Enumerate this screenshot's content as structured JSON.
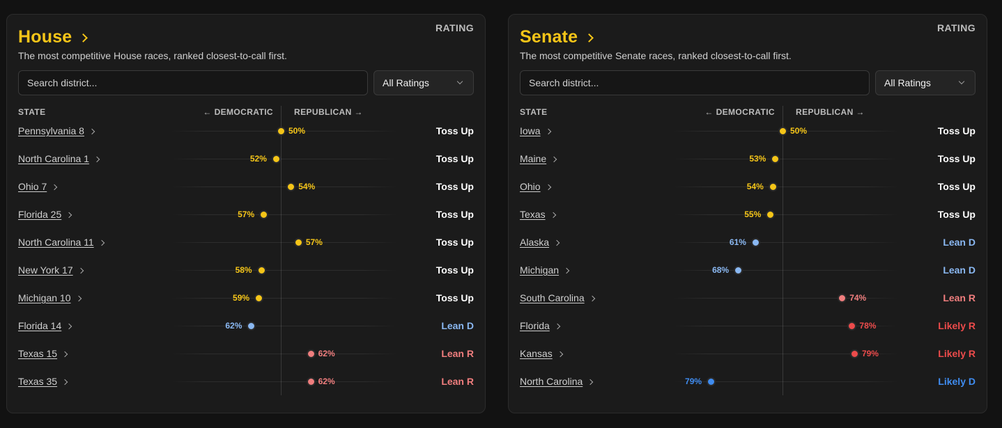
{
  "colors": {
    "tossup": "#f5c518",
    "lean_d": "#8ab8f2",
    "likely_d": "#3f8cf0",
    "lean_r": "#f07e7e",
    "likely_r": "#ec4b4b",
    "tossup_label": "#ffffff"
  },
  "house": {
    "title": "House",
    "subtitle": "The most competitive House races, ranked closest-to-call first.",
    "search_placeholder": "Search district...",
    "filter_value": "All Ratings",
    "col_state": "STATE",
    "col_dem": "DEMOCRATIC",
    "col_rep": "REPUBLICAN",
    "col_rating": "RATING",
    "races": [
      {
        "name": "Pennsylvania 8",
        "pct": "50%",
        "lean": 0,
        "rating": "Toss Up",
        "cat": "tossup"
      },
      {
        "name": "North Carolina 1",
        "pct": "52%",
        "lean": -2,
        "rating": "Toss Up",
        "cat": "tossup"
      },
      {
        "name": "Ohio 7",
        "pct": "54%",
        "lean": 4,
        "rating": "Toss Up",
        "cat": "tossup"
      },
      {
        "name": "Florida 25",
        "pct": "57%",
        "lean": -7,
        "rating": "Toss Up",
        "cat": "tossup"
      },
      {
        "name": "North Carolina 11",
        "pct": "57%",
        "lean": 7,
        "rating": "Toss Up",
        "cat": "tossup"
      },
      {
        "name": "New York 17",
        "pct": "58%",
        "lean": -8,
        "rating": "Toss Up",
        "cat": "tossup"
      },
      {
        "name": "Michigan 10",
        "pct": "59%",
        "lean": -9,
        "rating": "Toss Up",
        "cat": "tossup"
      },
      {
        "name": "Florida 14",
        "pct": "62%",
        "lean": -12,
        "rating": "Lean D",
        "cat": "lean_d"
      },
      {
        "name": "Texas 15",
        "pct": "62%",
        "lean": 12,
        "rating": "Lean R",
        "cat": "lean_r"
      },
      {
        "name": "Texas 35",
        "pct": "62%",
        "lean": 12,
        "rating": "Lean R",
        "cat": "lean_r"
      }
    ]
  },
  "senate": {
    "title": "Senate",
    "subtitle": "The most competitive Senate races, ranked closest-to-call first.",
    "search_placeholder": "Search district...",
    "filter_value": "All Ratings",
    "col_state": "STATE",
    "col_dem": "DEMOCRATIC",
    "col_rep": "REPUBLICAN",
    "col_rating": "RATING",
    "races": [
      {
        "name": "Iowa",
        "pct": "50%",
        "lean": 0,
        "rating": "Toss Up",
        "cat": "tossup"
      },
      {
        "name": "Maine",
        "pct": "53%",
        "lean": -3,
        "rating": "Toss Up",
        "cat": "tossup"
      },
      {
        "name": "Ohio",
        "pct": "54%",
        "lean": -4,
        "rating": "Toss Up",
        "cat": "tossup"
      },
      {
        "name": "Texas",
        "pct": "55%",
        "lean": -5,
        "rating": "Toss Up",
        "cat": "tossup"
      },
      {
        "name": "Alaska",
        "pct": "61%",
        "lean": -11,
        "rating": "Lean D",
        "cat": "lean_d"
      },
      {
        "name": "Michigan",
        "pct": "68%",
        "lean": -18,
        "rating": "Lean D",
        "cat": "lean_d"
      },
      {
        "name": "South Carolina",
        "pct": "74%",
        "lean": 24,
        "rating": "Lean R",
        "cat": "lean_r"
      },
      {
        "name": "Florida",
        "pct": "78%",
        "lean": 28,
        "rating": "Likely R",
        "cat": "likely_r"
      },
      {
        "name": "Kansas",
        "pct": "79%",
        "lean": 29,
        "rating": "Likely R",
        "cat": "likely_r"
      },
      {
        "name": "North Carolina",
        "pct": "79%",
        "lean": -29,
        "rating": "Likely D",
        "cat": "likely_d"
      }
    ]
  }
}
